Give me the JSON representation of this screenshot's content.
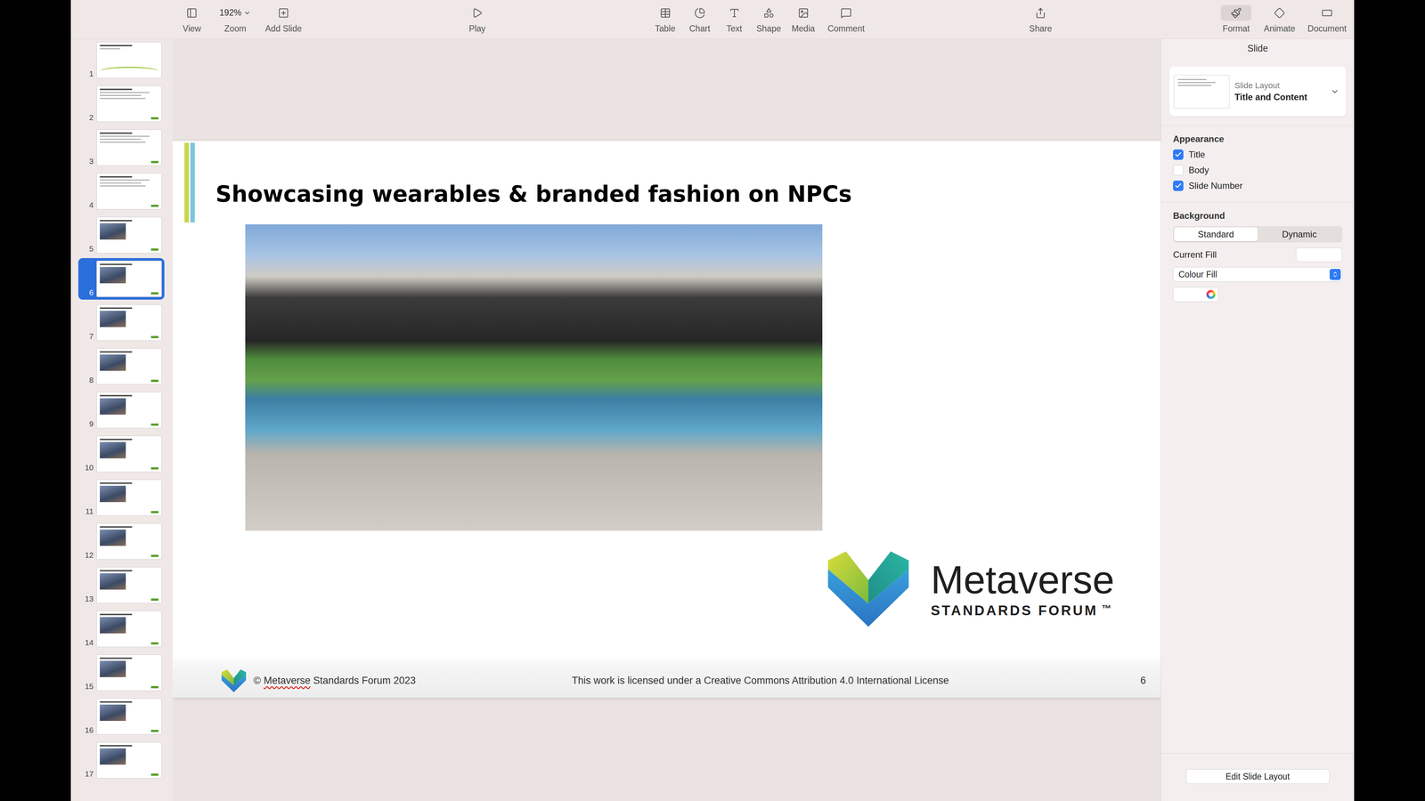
{
  "toolbar": {
    "items": [
      {
        "label": "View",
        "kind": "button",
        "selected": false
      },
      {
        "label": "Zoom",
        "kind": "zoom",
        "value": "192%",
        "selected": false
      },
      {
        "label": "Add Slide",
        "kind": "button",
        "selected": false
      },
      {
        "label": "Play",
        "kind": "button",
        "selected": false
      },
      {
        "label": "Table",
        "kind": "button",
        "selected": false
      },
      {
        "label": "Chart",
        "kind": "button",
        "selected": false
      },
      {
        "label": "Text",
        "kind": "button",
        "selected": false
      },
      {
        "label": "Shape",
        "kind": "button",
        "selected": false
      },
      {
        "label": "Media",
        "kind": "button",
        "selected": false
      },
      {
        "label": "Comment",
        "kind": "button",
        "selected": false
      },
      {
        "label": "Share",
        "kind": "button",
        "selected": false
      },
      {
        "label": "Format",
        "kind": "button",
        "selected": true
      },
      {
        "label": "Animate",
        "kind": "button",
        "selected": false
      },
      {
        "label": "Document",
        "kind": "button",
        "selected": false
      }
    ]
  },
  "navigator": {
    "slides": [
      {
        "number": "1",
        "kind": "title",
        "selected": false
      },
      {
        "number": "2",
        "kind": "text",
        "selected": false
      },
      {
        "number": "3",
        "kind": "text",
        "selected": false
      },
      {
        "number": "4",
        "kind": "text",
        "selected": false
      },
      {
        "number": "5",
        "kind": "image",
        "selected": false
      },
      {
        "number": "6",
        "kind": "image",
        "selected": true
      },
      {
        "number": "7",
        "kind": "image",
        "selected": false
      },
      {
        "number": "8",
        "kind": "image",
        "selected": false
      },
      {
        "number": "9",
        "kind": "image",
        "selected": false
      },
      {
        "number": "10",
        "kind": "image",
        "selected": false
      },
      {
        "number": "11",
        "kind": "image",
        "selected": false
      },
      {
        "number": "12",
        "kind": "image",
        "selected": false
      },
      {
        "number": "13",
        "kind": "image",
        "selected": false
      },
      {
        "number": "14",
        "kind": "image",
        "selected": false
      },
      {
        "number": "15",
        "kind": "image",
        "selected": false
      },
      {
        "number": "16",
        "kind": "image",
        "selected": false
      },
      {
        "number": "17",
        "kind": "image",
        "selected": false
      }
    ]
  },
  "slide": {
    "title": "Showcasing wearables & branded fashion on NPCs",
    "logo": {
      "name": "Metaverse",
      "tagline": "STANDARDS FORUM",
      "mark": "™"
    },
    "footer": {
      "copyright": [
        {
          "text": "©",
          "misspelled": false
        },
        {
          "text": "Metaverse",
          "misspelled": true
        },
        {
          "text": "Standards Forum 2023",
          "misspelled": false
        }
      ],
      "license": "This work is licensed under a Creative Commons Attribution 4.0 International License",
      "number": "6"
    }
  },
  "inspector": {
    "tab": "Slide",
    "layout": {
      "label": "Slide Layout",
      "value": "Title and Content"
    },
    "appearance": {
      "heading": "Appearance",
      "options": [
        {
          "label": "Title",
          "checked": true
        },
        {
          "label": "Body",
          "checked": false
        },
        {
          "label": "Slide Number",
          "checked": true
        }
      ]
    },
    "background": {
      "heading": "Background",
      "modes": [
        {
          "label": "Standard",
          "selected": true
        },
        {
          "label": "Dynamic",
          "selected": false
        }
      ],
      "current_fill": "Current Fill",
      "fill_type": "Colour Fill"
    },
    "edit_button": "Edit Slide Layout"
  }
}
